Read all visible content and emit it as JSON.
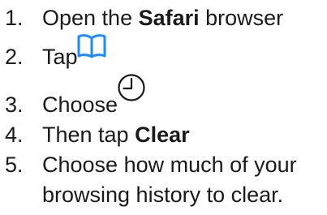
{
  "steps": [
    {
      "number": "1.",
      "before": "Open the ",
      "bold": "Safari",
      "after": " browser"
    },
    {
      "number": "2.",
      "before": "Tap",
      "icon": "book-icon",
      "icon_color": "#1a8cff"
    },
    {
      "number": "3.",
      "before": "Choose",
      "icon": "clock-icon",
      "icon_color": "#1a1a1a"
    },
    {
      "number": "4.",
      "before": "Then tap ",
      "bold": "Clear"
    },
    {
      "number": "5.",
      "line1": "Choose how much of your",
      "line2": "browsing history to clear."
    }
  ]
}
